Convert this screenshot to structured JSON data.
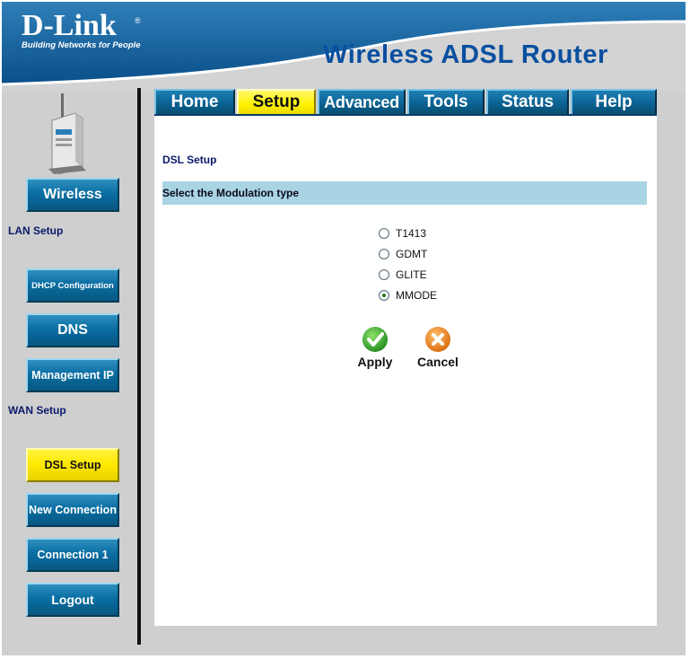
{
  "header": {
    "logo_text": "D-Link",
    "logo_registered": "®",
    "logo_tagline": "Building Networks for People",
    "product_title": "Wireless ADSL Router"
  },
  "tabs": [
    {
      "label": "Home",
      "active": false
    },
    {
      "label": "Setup",
      "active": true
    },
    {
      "label": "Advanced",
      "active": false
    },
    {
      "label": "Tools",
      "active": false
    },
    {
      "label": "Status",
      "active": false
    },
    {
      "label": "Help",
      "active": false
    }
  ],
  "sidebar": {
    "wireless_button": "Wireless",
    "lan_heading": "LAN Setup",
    "dhcp_button": "DHCP Configuration",
    "dns_button": "DNS",
    "management_ip_button": "Management IP",
    "wan_heading": "WAN Setup",
    "dsl_setup_button": "DSL Setup",
    "new_connection_button": "New Connection",
    "connection1_button": "Connection 1",
    "logout_button": "Logout"
  },
  "main": {
    "section_title": "DSL Setup",
    "bar_title": "Select the Modulation type",
    "modulation_options": [
      {
        "label": "T1413",
        "checked": false
      },
      {
        "label": "GDMT",
        "checked": false
      },
      {
        "label": "GLITE",
        "checked": false
      },
      {
        "label": "MMODE",
        "checked": true
      }
    ],
    "apply_label": "Apply",
    "cancel_label": "Cancel"
  },
  "colors": {
    "accent_blue": "#0a5f8f",
    "active_yellow": "#fff200",
    "bar_blue": "#a9d4e3",
    "title_blue": "#0a4fa0"
  }
}
